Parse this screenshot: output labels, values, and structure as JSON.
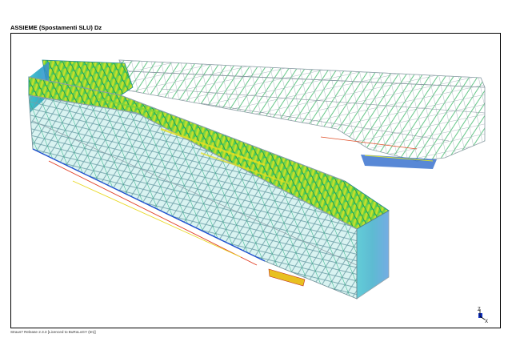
{
  "view": {
    "title": "ASSIEME (Spostamenti SLU) Dz",
    "footer": "Straus7 Release 2.3.3 [Licenced to BuRoLoGY (tm)]"
  },
  "axis_triad": {
    "z_label": "Z",
    "x_label": "X"
  },
  "colors": {
    "frame_members": "#9aa9b0",
    "contour_low": "#0a3cc8",
    "contour_mid_low": "#00b8d0",
    "contour_mid": "#22c040",
    "contour_mid_high": "#e8e020",
    "contour_high": "#e82020"
  }
}
